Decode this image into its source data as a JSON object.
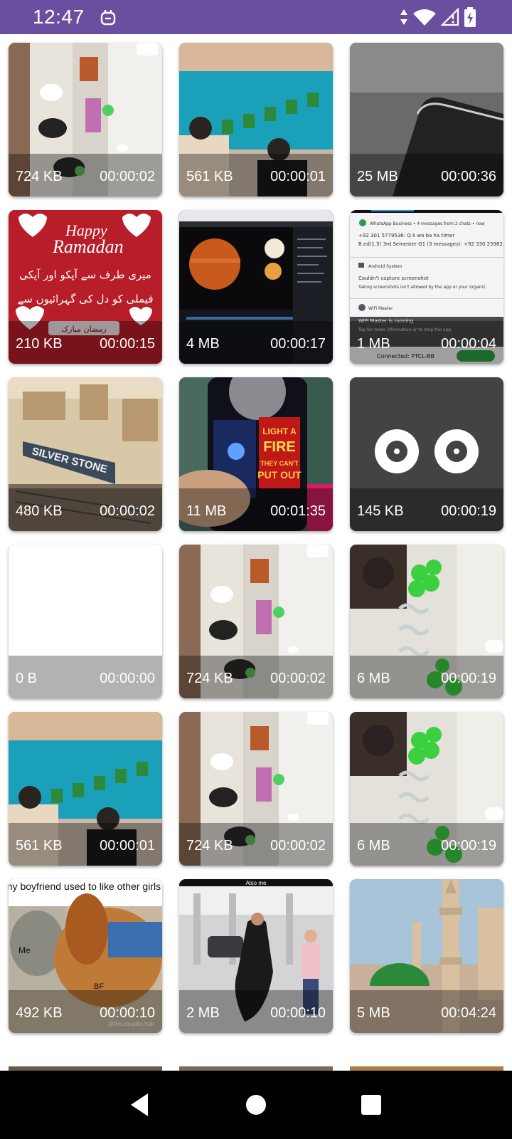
{
  "status_bar": {
    "time": "12:47",
    "background": "#6a4fa0"
  },
  "videos": [
    {
      "size": "724 KB",
      "duration": "00:00:02",
      "thumb": "party-room"
    },
    {
      "size": "561 KB",
      "duration": "00:00:01",
      "thumb": "teal-curtain"
    },
    {
      "size": "25 MB",
      "duration": "00:00:36",
      "thumb": "phone-closeup"
    },
    {
      "size": "210 KB",
      "duration": "00:00:15",
      "thumb": "ramadan-card"
    },
    {
      "size": "4 MB",
      "duration": "00:00:17",
      "thumb": "planets-editor"
    },
    {
      "size": "1 MB",
      "duration": "00:00:04",
      "thumb": "notification-screen"
    },
    {
      "size": "480 KB",
      "duration": "00:00:02",
      "thumb": "silver-stone-building"
    },
    {
      "size": "11 MB",
      "duration": "00:01:35",
      "thumb": "phone-science-poster"
    },
    {
      "size": "145 KB",
      "duration": "00:00:19",
      "thumb": "dark-eyes"
    },
    {
      "size": "0 B",
      "duration": "00:00:00",
      "thumb": "blank"
    },
    {
      "size": "724 KB",
      "duration": "00:00:02",
      "thumb": "party-room"
    },
    {
      "size": "6 MB",
      "duration": "00:00:19",
      "thumb": "green-balloons"
    },
    {
      "size": "561 KB",
      "duration": "00:00:01",
      "thumb": "teal-curtain"
    },
    {
      "size": "724 KB",
      "duration": "00:00:02",
      "thumb": "party-room"
    },
    {
      "size": "6 MB",
      "duration": "00:00:19",
      "thumb": "green-balloons"
    },
    {
      "size": "492 KB",
      "duration": "00:00:10",
      "thumb": "cat-dog-meme"
    },
    {
      "size": "2 MB",
      "duration": "00:00:10",
      "thumb": "airport-walk"
    },
    {
      "size": "5 MB",
      "duration": "00:04:24",
      "thumb": "green-dome"
    }
  ],
  "thumb_text": {
    "ramadan_happy": "Happy",
    "ramadan_title": "Ramadan",
    "ramadan_urdu_1": "میری طرف سے آپکو اور آپکی",
    "ramadan_urdu_2": "فیملی کو دل کی گہرائیوں سے",
    "ramadan_badge": "رمضان مبارک",
    "notif_1": "WhatsApp Business • 4 messages from 2 chats • now",
    "notif_2": "+92 301 5779536: Q k wo ba ha timer",
    "notif_3": "B.ed(1.5) 3rd Semester G1 (3 messages): +92 330 25982...",
    "notif_4": "Android System",
    "notif_5": "Couldn't capture screenshot",
    "notif_6": "Taking screenshots isn't allowed by the app or your organiz.",
    "notif_7": "WiFi Master",
    "notif_8": "WiFi Master is running",
    "notif_9": "Tap for more information or to stop the app.",
    "notif_10": "Connected: PTCL-BB",
    "silver_stone": "SILVER STONE",
    "poster_1": "LIGHT A",
    "poster_2": "FIRE",
    "poster_3": "THEY CAN'T",
    "poster_4": "PUT OUT",
    "meme_caption": "my boyfriend used to like other girls",
    "meme_me": "Me",
    "meme_bf": "BF",
    "meme_handle": "@the.couples.hub",
    "airport_caption": "Also me"
  }
}
